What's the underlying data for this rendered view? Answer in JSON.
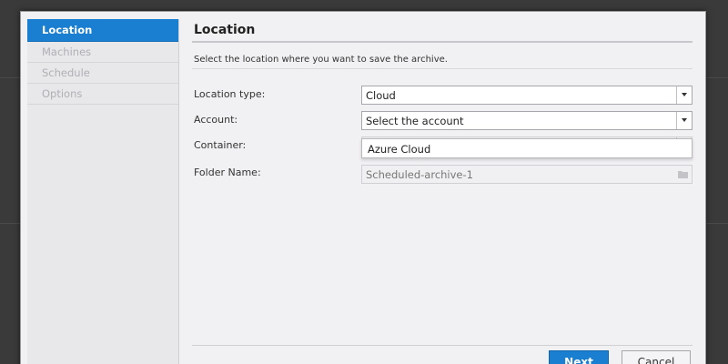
{
  "sidebar": {
    "items": [
      {
        "label": "Location",
        "active": true
      },
      {
        "label": "Machines",
        "active": false
      },
      {
        "label": "Schedule",
        "active": false
      },
      {
        "label": "Options",
        "active": false
      }
    ]
  },
  "main": {
    "title": "Location",
    "description": "Select the location where you want to save the archive."
  },
  "form": {
    "location_type": {
      "label": "Location type:",
      "value": "Cloud"
    },
    "account": {
      "label": "Account:",
      "value": "Select the account",
      "options": [
        "Azure Cloud"
      ]
    },
    "container": {
      "label": "Container:",
      "value": ""
    },
    "folder_name": {
      "label": "Folder Name:",
      "value": "Scheduled-archive-1"
    }
  },
  "buttons": {
    "next": "Next",
    "cancel": "Cancel"
  },
  "colors": {
    "accent": "#1a7fd0",
    "background": "#f1f0f2"
  },
  "icons": {
    "dropdown": "chevron-down-icon",
    "folder": "folder-icon"
  }
}
